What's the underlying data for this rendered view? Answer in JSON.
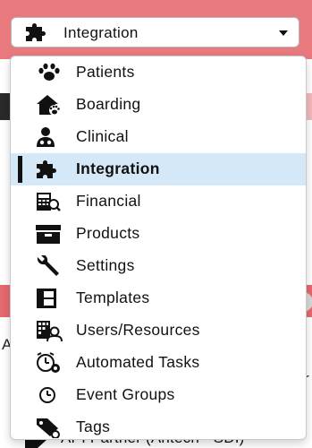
{
  "select": {
    "value": "Integration",
    "icon": "puzzle-icon"
  },
  "menu": {
    "items": [
      {
        "label": "Patients",
        "icon": "paw-icon",
        "active": false
      },
      {
        "label": "Boarding",
        "icon": "house-paw-icon",
        "active": false
      },
      {
        "label": "Clinical",
        "icon": "doctor-icon",
        "active": false
      },
      {
        "label": "Integration",
        "icon": "puzzle-icon",
        "active": true
      },
      {
        "label": "Financial",
        "icon": "cash-register-icon",
        "active": false
      },
      {
        "label": "Products",
        "icon": "box-icon",
        "active": false
      },
      {
        "label": "Settings",
        "icon": "wrench-icon",
        "active": false
      },
      {
        "label": "Templates",
        "icon": "layout-icon",
        "active": false
      },
      {
        "label": "Users/Resources",
        "icon": "building-user-icon",
        "active": false
      },
      {
        "label": "Automated Tasks",
        "icon": "alarm-gear-icon",
        "active": false
      },
      {
        "label": "Event Groups",
        "icon": "clock-circle-icon",
        "active": false
      },
      {
        "label": "Tags",
        "icon": "tag-gear-icon",
        "active": false
      }
    ]
  },
  "background": {
    "partial_text_left": "A",
    "partial_text_right": "r",
    "bottom_row_text": "API Partner (Antech - SDI) -"
  },
  "colors": {
    "header_band": "#e87a7e",
    "active_item_bg": "#d4e8f7",
    "active_bar": "#111111"
  }
}
